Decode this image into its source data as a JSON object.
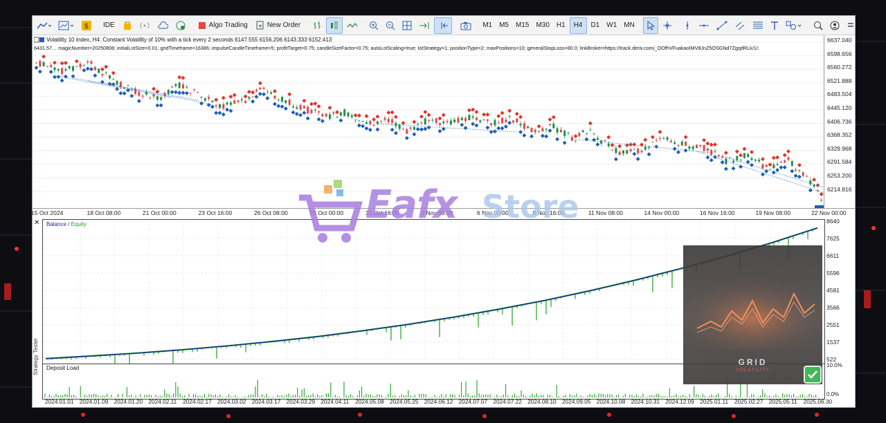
{
  "toolbar": {
    "ide_label": "IDE",
    "algo_trading_label": "Algo Trading",
    "new_order_label": "New Order",
    "timeframes": [
      "M1",
      "M5",
      "M15",
      "M30",
      "H1",
      "H4",
      "D1",
      "W1",
      "MN"
    ],
    "active_timeframe": "H4"
  },
  "chart": {
    "info_line1": "Volatility 10 Index, H4:  Constant Volatility of 10% with a tick every 2 seconds  6147.555 6156.206 6143.333 6152.413",
    "info_line2": "6431.57…  magicNumber=20250808; initialLotSize=0.01; gridTimeframe=16386; impulseCandleTimeframe=5; profitTarget=0.75; candleSizeFactor=0.75; autoLotScaling=true; lotStrategy=1; positionType=2; maxPositions=10; generalStopLoss=80.0; linkBroker=https://track.deriv.com/_OOfhVFuakaoIMV8JnZ5OSGNd7ZgqdRLk/1/;",
    "price_labels": [
      "6637.040",
      "6598.656",
      "6560.272",
      "6521.888",
      "6483.504",
      "6445.120",
      "6406.736",
      "6368.352",
      "6329.968",
      "6291.584",
      "6253.200",
      "6214.816"
    ],
    "time_labels": [
      "15 Oct 2024",
      "18 Oct 08:00",
      "21 Oct 00:00",
      "23 Oct 16:00",
      "26 Oct 08:00",
      "29 Oct 00:00",
      "31 Oct 16:00",
      "3 Nov 08:00",
      "6 Nov 00:00",
      "8 Nov 16:00",
      "11 Nov 08:00",
      "14 Nov 00:00",
      "16 Nov 16:00",
      "19 Nov 08:00",
      "22 Nov 00:00"
    ],
    "up_color": "#1f8f4a",
    "down_color": "#d94a4a",
    "buy_marker_color": "#1f5fb5",
    "sell_marker_color": "#e0352b"
  },
  "tester": {
    "legend_balance": "Balance",
    "legend_sep": " / ",
    "legend_equity": "Equity",
    "balance_color": "#1a2a9a",
    "equity_color": "#1aa31a",
    "scale_labels": [
      "8640",
      "7625",
      "6611",
      "5596",
      "4581",
      "3566",
      "2551",
      "1537",
      "522"
    ],
    "deposit_label": "Deposit Load",
    "deposit_scale": [
      "10.0%",
      "0.0%"
    ],
    "date_labels": [
      "2024.01.01",
      "2024.01.09",
      "2024.01.20",
      "2024.02.11",
      "2024.02.17",
      "2024.03.02",
      "2024.03.17",
      "2024.03.29",
      "2024.04.11",
      "2024.05.08",
      "2024.05.25",
      "2024.06.12",
      "2024.07.07",
      "2024.07.22",
      "2024.08.10",
      "2024.09.05",
      "2024.10.08",
      "2024.10.31",
      "2024.12.09",
      "2025.01.11",
      "2025.02.27",
      "2025.05.11",
      "2025.06.30"
    ],
    "side_label": "Strategy Tester",
    "close_glyph": "✕"
  },
  "watermark": {
    "text1": "Eafx",
    "text2": "Store"
  },
  "overlay": {
    "title": "GRID",
    "subtitle": "VOLATILITY"
  },
  "chart_data": [
    {
      "type": "line",
      "title": "",
      "series": [
        {
          "name": "Balance",
          "values": [
            800,
            950,
            1110,
            1300,
            1520,
            1770,
            2050,
            2380,
            2740,
            3150,
            3600,
            4090,
            4640,
            5240,
            5890,
            6590,
            7350,
            8180
          ]
        },
        {
          "name": "Equity",
          "values": [
            800,
            950,
            1110,
            1300,
            1520,
            1770,
            2050,
            2380,
            2740,
            3150,
            3600,
            4090,
            4640,
            5240,
            5890,
            6590,
            7350,
            8180
          ]
        }
      ],
      "ylim": [
        522,
        8640
      ]
    },
    {
      "type": "bar",
      "title": "",
      "ylim": [
        0,
        10
      ]
    }
  ]
}
